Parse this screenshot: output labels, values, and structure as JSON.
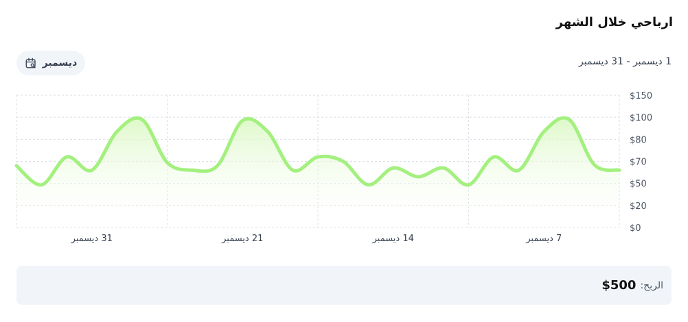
{
  "header": {
    "title": "ارباحي خلال الشهر",
    "date_range": "1 ديسمبر - 31 ديسمبر",
    "month_button_label": "ديسمبر",
    "month_button_icon": "calendar-search-icon"
  },
  "chart_data": {
    "type": "area",
    "y_ticks": [
      "$150",
      "$100",
      "$80",
      "$70",
      "$50",
      "$20",
      "$0"
    ],
    "x_tick_labels": [
      "31 ديسمبر",
      "21 ديسمبر",
      "14 ديسمبر",
      "7 ديسمبر"
    ],
    "line_color": "#a3f07f",
    "fill_color": "#e8fbd9",
    "grid": true,
    "series": [
      {
        "values": [
          66,
          48,
          72,
          62,
          87,
          98,
          69,
          62,
          66,
          97,
          87,
          62,
          72,
          70,
          48,
          64,
          56,
          64,
          48,
          72,
          62,
          87,
          98,
          67,
          62
        ]
      }
    ]
  },
  "summary": {
    "profit_label": "الربح:",
    "profit_value": "$500"
  }
}
